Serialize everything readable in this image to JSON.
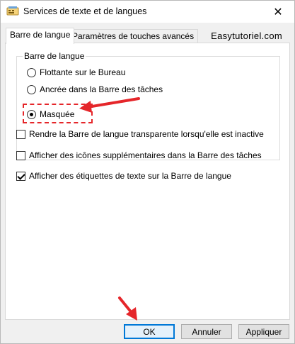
{
  "window": {
    "title": "Services de texte et de langues",
    "close_glyph": "✕"
  },
  "tabs": [
    {
      "label": "Barre de langue",
      "active": true
    },
    {
      "label": "Paramètres de touches avancés",
      "active": false
    }
  ],
  "brand": "Easytutoriel.com",
  "group": {
    "legend": "Barre de langue",
    "options": [
      {
        "label": "Flottante sur le Bureau",
        "checked": false
      },
      {
        "label": "Ancrée dans la Barre des tâches",
        "checked": false
      },
      {
        "label": "Masquée",
        "checked": true
      }
    ]
  },
  "checkboxes": [
    {
      "label": "Rendre la Barre de langue transparente lorsqu'elle est inactive",
      "checked": false
    },
    {
      "label": "Afficher des icônes supplémentaires dans la Barre des tâches",
      "checked": false
    },
    {
      "label": "Afficher des étiquettes de texte sur la Barre de langue",
      "checked": true
    }
  ],
  "buttons": {
    "ok": "OK",
    "cancel": "Annuler",
    "apply": "Appliquer"
  },
  "icons": {
    "window_icon": "language-bar-icon",
    "close": "close-icon"
  },
  "colors": {
    "annotation_red": "#e5262a",
    "default_button_border": "#0078d7"
  }
}
